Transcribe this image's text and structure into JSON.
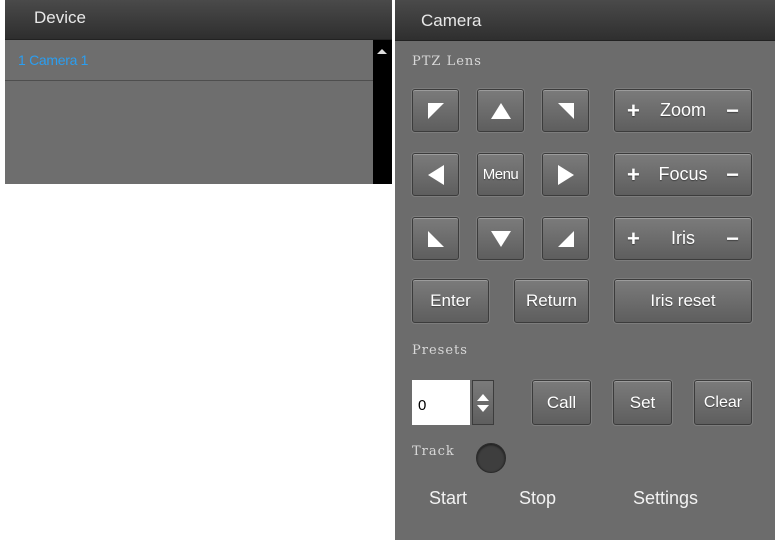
{
  "device_panel": {
    "title": "Device",
    "items": [
      {
        "label": "1  Camera 1"
      }
    ]
  },
  "camera_panel": {
    "title": "Camera",
    "ptz_label": "PTZ Lens",
    "menu_label": "Menu",
    "lens_controls": [
      {
        "label": "Zoom",
        "plus": "+",
        "minus": "−"
      },
      {
        "label": "Focus",
        "plus": "+",
        "minus": "−"
      },
      {
        "label": "Iris",
        "plus": "+",
        "minus": "−"
      }
    ],
    "enter_label": "Enter",
    "return_label": "Return",
    "iris_reset_label": "Iris reset",
    "presets_label": "Presets",
    "preset_value": "0",
    "call_label": "Call",
    "set_label": "Set",
    "clear_label": "Clear",
    "track_label": "Track",
    "start_label": "Start",
    "stop_label": "Stop",
    "settings_label": "Settings"
  },
  "colors": {
    "panel_bg": "#6c6c6c",
    "header_bg": "#3a3a3a",
    "link_blue": "#2b9ef0"
  },
  "icons": {
    "up_left": "arrow-up-left-icon",
    "up": "arrow-up-icon",
    "up_right": "arrow-up-right-icon",
    "left": "arrow-left-icon",
    "right": "arrow-right-icon",
    "down_left": "arrow-down-left-icon",
    "down": "arrow-down-icon",
    "down_right": "arrow-down-right-icon"
  }
}
